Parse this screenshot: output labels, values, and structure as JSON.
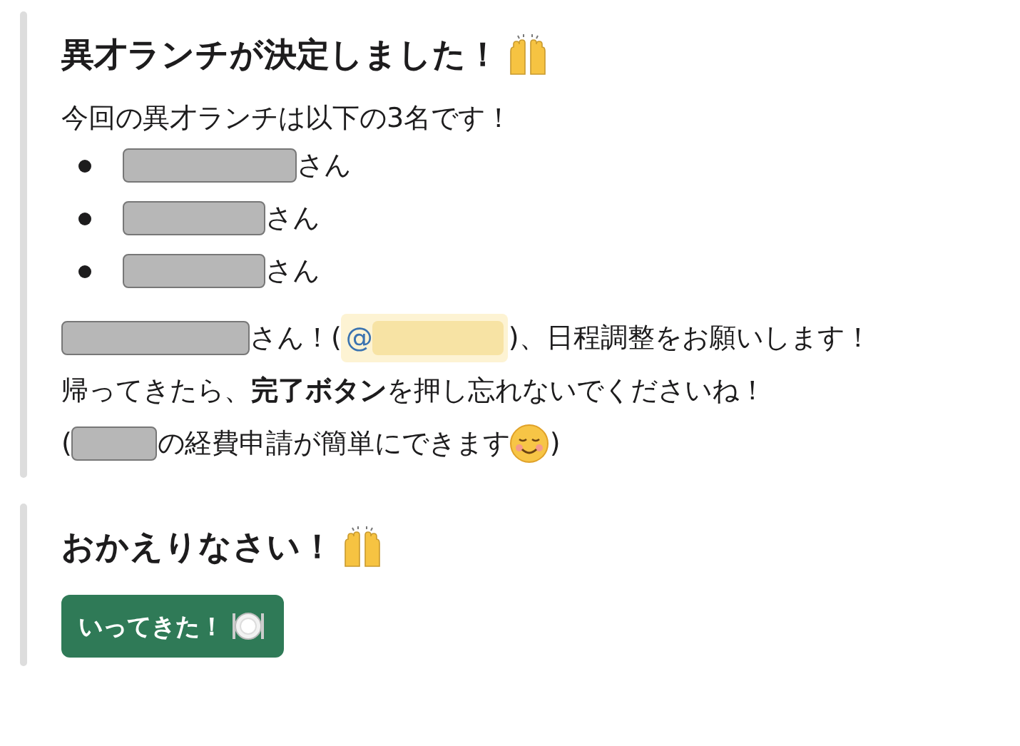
{
  "sections": [
    {
      "title": "異才ランチが決定しました！",
      "celebrating": true,
      "intro": "今回の異才ランチは以下の3名です！",
      "members": [
        {
          "suffix": "さん"
        },
        {
          "suffix": "さん"
        },
        {
          "suffix": "さん"
        }
      ],
      "message_lines": [
        [
          {
            "kind": "redacted"
          },
          {
            "kind": "text",
            "text": "さん！("
          },
          {
            "kind": "mention",
            "text": "@"
          },
          {
            "kind": "text",
            "text": ")、日程調整をお願いします！"
          }
        ],
        [
          {
            "kind": "text",
            "text": "帰ってきたら、**完了ボタン**を押し忘れないでくださいね！"
          }
        ],
        [
          {
            "kind": "text",
            "text": "("
          },
          {
            "kind": "redacted"
          },
          {
            "kind": "text",
            "text": "の経費申請が簡単にできます"
          },
          {
            "kind": "emoji"
          },
          {
            "kind": "text",
            "text": ")"
          }
        ]
      ]
    },
    {
      "title": "おかえりなさい！",
      "celebrating": true,
      "button": {
        "label": "いってきた！"
      }
    }
  ]
}
